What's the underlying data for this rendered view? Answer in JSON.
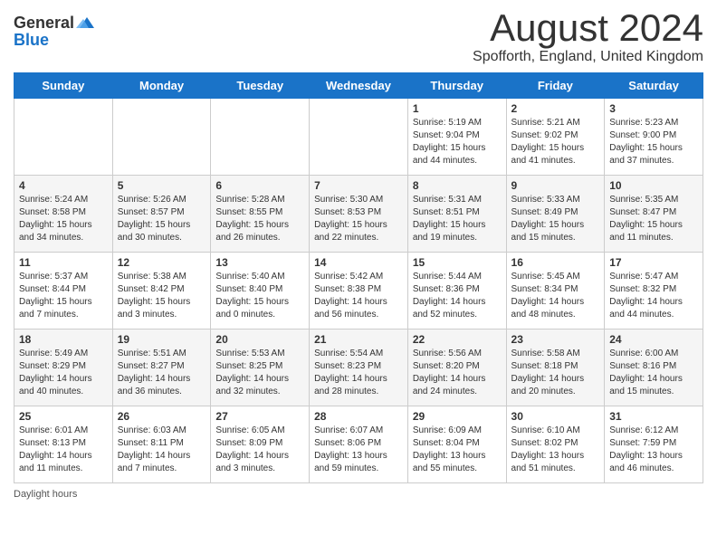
{
  "header": {
    "logo_line1": "General",
    "logo_line2": "Blue",
    "month_title": "August 2024",
    "location": "Spofforth, England, United Kingdom"
  },
  "weekdays": [
    "Sunday",
    "Monday",
    "Tuesday",
    "Wednesday",
    "Thursday",
    "Friday",
    "Saturday"
  ],
  "weeks": [
    [
      {
        "day": "",
        "sunrise": "",
        "sunset": "",
        "daylight": ""
      },
      {
        "day": "",
        "sunrise": "",
        "sunset": "",
        "daylight": ""
      },
      {
        "day": "",
        "sunrise": "",
        "sunset": "",
        "daylight": ""
      },
      {
        "day": "",
        "sunrise": "",
        "sunset": "",
        "daylight": ""
      },
      {
        "day": "1",
        "sunrise": "5:19 AM",
        "sunset": "9:04 PM",
        "daylight": "15 hours and 44 minutes."
      },
      {
        "day": "2",
        "sunrise": "5:21 AM",
        "sunset": "9:02 PM",
        "daylight": "15 hours and 41 minutes."
      },
      {
        "day": "3",
        "sunrise": "5:23 AM",
        "sunset": "9:00 PM",
        "daylight": "15 hours and 37 minutes."
      }
    ],
    [
      {
        "day": "4",
        "sunrise": "5:24 AM",
        "sunset": "8:58 PM",
        "daylight": "15 hours and 34 minutes."
      },
      {
        "day": "5",
        "sunrise": "5:26 AM",
        "sunset": "8:57 PM",
        "daylight": "15 hours and 30 minutes."
      },
      {
        "day": "6",
        "sunrise": "5:28 AM",
        "sunset": "8:55 PM",
        "daylight": "15 hours and 26 minutes."
      },
      {
        "day": "7",
        "sunrise": "5:30 AM",
        "sunset": "8:53 PM",
        "daylight": "15 hours and 22 minutes."
      },
      {
        "day": "8",
        "sunrise": "5:31 AM",
        "sunset": "8:51 PM",
        "daylight": "15 hours and 19 minutes."
      },
      {
        "day": "9",
        "sunrise": "5:33 AM",
        "sunset": "8:49 PM",
        "daylight": "15 hours and 15 minutes."
      },
      {
        "day": "10",
        "sunrise": "5:35 AM",
        "sunset": "8:47 PM",
        "daylight": "15 hours and 11 minutes."
      }
    ],
    [
      {
        "day": "11",
        "sunrise": "5:37 AM",
        "sunset": "8:44 PM",
        "daylight": "15 hours and 7 minutes."
      },
      {
        "day": "12",
        "sunrise": "5:38 AM",
        "sunset": "8:42 PM",
        "daylight": "15 hours and 3 minutes."
      },
      {
        "day": "13",
        "sunrise": "5:40 AM",
        "sunset": "8:40 PM",
        "daylight": "15 hours and 0 minutes."
      },
      {
        "day": "14",
        "sunrise": "5:42 AM",
        "sunset": "8:38 PM",
        "daylight": "14 hours and 56 minutes."
      },
      {
        "day": "15",
        "sunrise": "5:44 AM",
        "sunset": "8:36 PM",
        "daylight": "14 hours and 52 minutes."
      },
      {
        "day": "16",
        "sunrise": "5:45 AM",
        "sunset": "8:34 PM",
        "daylight": "14 hours and 48 minutes."
      },
      {
        "day": "17",
        "sunrise": "5:47 AM",
        "sunset": "8:32 PM",
        "daylight": "14 hours and 44 minutes."
      }
    ],
    [
      {
        "day": "18",
        "sunrise": "5:49 AM",
        "sunset": "8:29 PM",
        "daylight": "14 hours and 40 minutes."
      },
      {
        "day": "19",
        "sunrise": "5:51 AM",
        "sunset": "8:27 PM",
        "daylight": "14 hours and 36 minutes."
      },
      {
        "day": "20",
        "sunrise": "5:53 AM",
        "sunset": "8:25 PM",
        "daylight": "14 hours and 32 minutes."
      },
      {
        "day": "21",
        "sunrise": "5:54 AM",
        "sunset": "8:23 PM",
        "daylight": "14 hours and 28 minutes."
      },
      {
        "day": "22",
        "sunrise": "5:56 AM",
        "sunset": "8:20 PM",
        "daylight": "14 hours and 24 minutes."
      },
      {
        "day": "23",
        "sunrise": "5:58 AM",
        "sunset": "8:18 PM",
        "daylight": "14 hours and 20 minutes."
      },
      {
        "day": "24",
        "sunrise": "6:00 AM",
        "sunset": "8:16 PM",
        "daylight": "14 hours and 15 minutes."
      }
    ],
    [
      {
        "day": "25",
        "sunrise": "6:01 AM",
        "sunset": "8:13 PM",
        "daylight": "14 hours and 11 minutes."
      },
      {
        "day": "26",
        "sunrise": "6:03 AM",
        "sunset": "8:11 PM",
        "daylight": "14 hours and 7 minutes."
      },
      {
        "day": "27",
        "sunrise": "6:05 AM",
        "sunset": "8:09 PM",
        "daylight": "14 hours and 3 minutes."
      },
      {
        "day": "28",
        "sunrise": "6:07 AM",
        "sunset": "8:06 PM",
        "daylight": "13 hours and 59 minutes."
      },
      {
        "day": "29",
        "sunrise": "6:09 AM",
        "sunset": "8:04 PM",
        "daylight": "13 hours and 55 minutes."
      },
      {
        "day": "30",
        "sunrise": "6:10 AM",
        "sunset": "8:02 PM",
        "daylight": "13 hours and 51 minutes."
      },
      {
        "day": "31",
        "sunrise": "6:12 AM",
        "sunset": "7:59 PM",
        "daylight": "13 hours and 46 minutes."
      }
    ]
  ],
  "footer": {
    "daylight_label": "Daylight hours"
  }
}
